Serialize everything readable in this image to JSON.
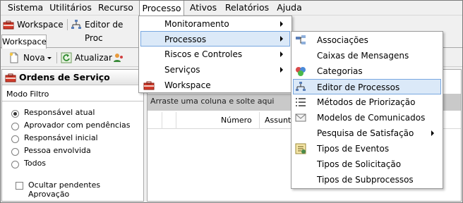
{
  "menubar": {
    "items": [
      "Sistema",
      "Utilitários",
      "Recurso",
      "Processo",
      "Ativos",
      "Relatórios",
      "Ajuda"
    ],
    "active": "Processo"
  },
  "toolbar1": {
    "workspace_label": "Workspace",
    "editor_label": "Editor de Proc"
  },
  "tab": {
    "label": "Workspace"
  },
  "toolbar2": {
    "new_label": "Nova",
    "update_label": "Atualizar"
  },
  "panel": {
    "title": "Ordens de Serviço",
    "mode_label": "Modo Filtro",
    "options": [
      "Responsável atual",
      "Aprovador com pendências",
      "Responsável inicial",
      "Pessoa envolvida",
      "Todos"
    ],
    "selected": "Responsável atual",
    "checkbox_label": "Ocultar pendentes Aprovação"
  },
  "content": {
    "group_hint": "Arraste uma coluna e solte aqui",
    "columns": [
      "Número",
      "Assunto"
    ]
  },
  "processo_menu": {
    "items": [
      "Monitoramento",
      "Processos",
      "Riscos e Controles",
      "Serviços",
      "Workspace"
    ],
    "highlighted": "Processos"
  },
  "processos_submenu": {
    "items": [
      "Associações",
      "Caixas de Mensagens",
      "Categorias",
      "Editor de Processos",
      "Métodos de Priorização",
      "Modelos de Comunicados",
      "Pesquisa de Satisfação",
      "Tipos de Eventos",
      "Tipos de Solicitação",
      "Tipos de Subprocessos"
    ],
    "highlighted": "Editor de Processos"
  },
  "colors": {
    "highlight_bg": "#dbe9f8",
    "highlight_border": "#78a7e0",
    "group_bar": "#c9c9c9"
  }
}
